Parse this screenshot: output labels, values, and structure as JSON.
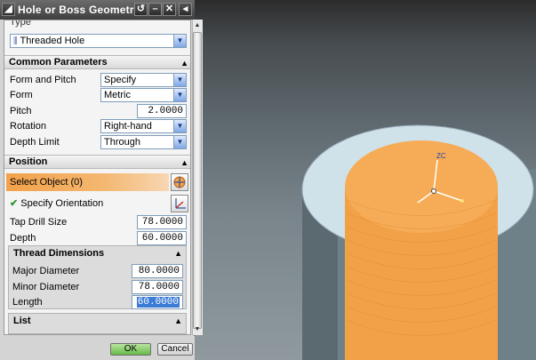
{
  "dialog": {
    "title": "Hole or Boss Geometry",
    "title_icon": "hole-geometry-icon",
    "titlebar_buttons": [
      "reset",
      "collapse",
      "close",
      "more"
    ]
  },
  "type_section": {
    "label": "Type",
    "value": "Threaded Hole"
  },
  "common_parameters": {
    "label": "Common Parameters",
    "rows": [
      {
        "label": "Form and Pitch",
        "value": "Specify"
      },
      {
        "label": "Form",
        "value": "Metric"
      },
      {
        "label": "Pitch",
        "value": "2.0000"
      },
      {
        "label": "Rotation",
        "value": "Right-hand"
      },
      {
        "label": "Depth Limit",
        "value": "Through"
      }
    ]
  },
  "position": {
    "label": "Position",
    "select_object": "Select Object (0)",
    "specify_orientation": "Specify Orientation",
    "tap_drill_label": "Tap Drill Size",
    "tap_drill_value": "78.0000",
    "depth_label": "Depth",
    "depth_value": "60.0000"
  },
  "thread_dimensions": {
    "label": "Thread Dimensions",
    "rows": [
      {
        "label": "Major Diameter",
        "value": "80.0000"
      },
      {
        "label": "Minor Diameter",
        "value": "78.0000"
      },
      {
        "label": "Length",
        "value": "60.0000"
      }
    ]
  },
  "list": {
    "label": "List"
  },
  "footer": {
    "ok": "OK",
    "cancel": "Cancel"
  },
  "viewport": {
    "axis_label": "ZC",
    "colors": {
      "cylinder_body": "#74868d",
      "top_face": "#cde0e8",
      "thread_orange": "#f4a34a",
      "selection_highlight": "#3a7bd5"
    }
  }
}
